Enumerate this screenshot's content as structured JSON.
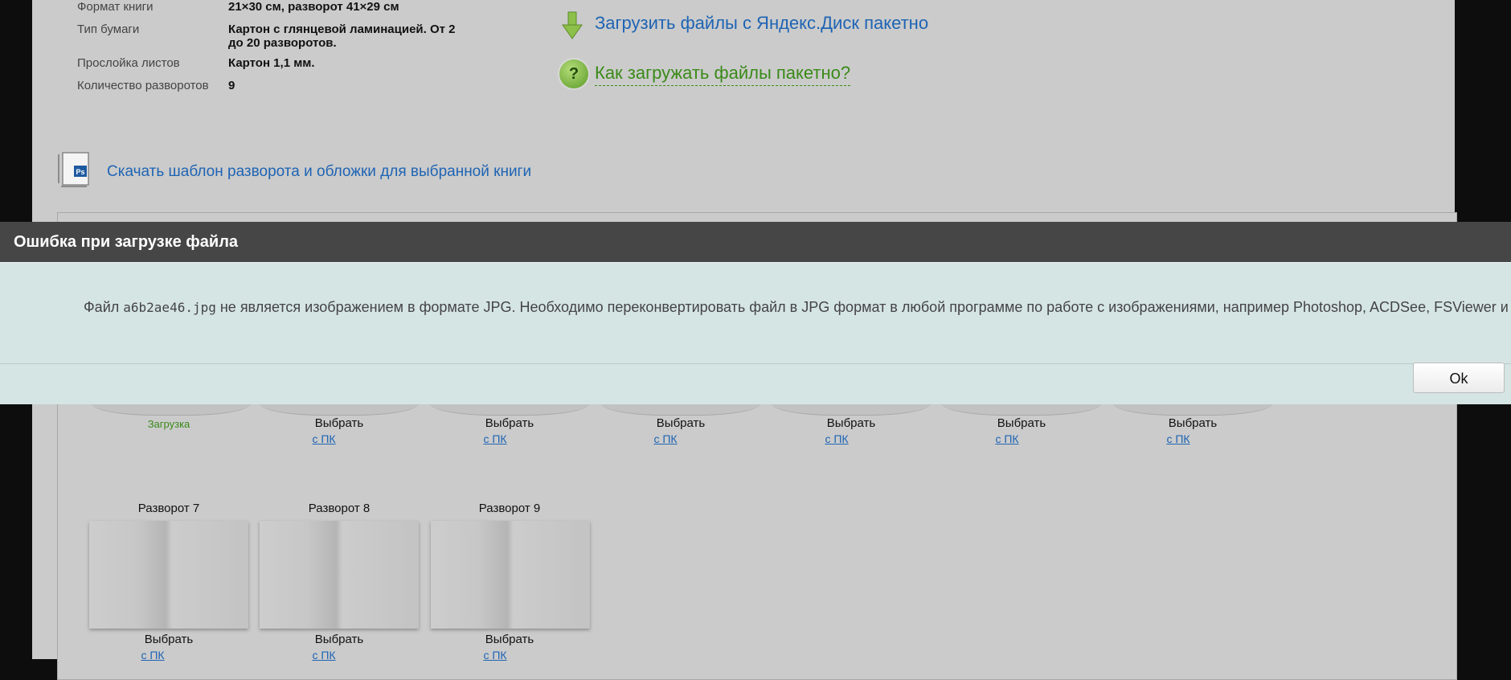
{
  "specs": [
    {
      "label": "Формат книги",
      "value": "21×30 см, разворот 41×29 см"
    },
    {
      "label": "Тип бумаги",
      "value": "Картон с глянцевой ламинацией. От 2 до 20 разворотов."
    },
    {
      "label": "Прослойка листов",
      "value": "Картон 1,1 мм."
    },
    {
      "label": "Количество разворотов",
      "value": "9"
    }
  ],
  "links": {
    "upload_yadisk": "Загрузить файлы с Яндекс.Диск пакетно",
    "how_upload": "Как загружать файлы пакетно?",
    "download_template": "Скачать шаблон разворота и обложки для выбранной книги"
  },
  "row1": {
    "loading": "Загрузка",
    "select_label": "Выбрать",
    "pc_label": "с ПК"
  },
  "row2": [
    {
      "title": "Разворот 7",
      "select": "Выбрать",
      "pc": "с ПК"
    },
    {
      "title": "Разворот 8",
      "select": "Выбрать",
      "pc": "с ПК"
    },
    {
      "title": "Разворот 9",
      "select": "Выбрать",
      "pc": "с ПК"
    }
  ],
  "dialog": {
    "title": "Ошибка при загрузке файла",
    "msg_prefix": "Файл ",
    "filename": "a6b2ae46.jpg",
    "msg_suffix": " не является изображением в формате JPG. Необходимо переконвертировать файл в JPG формат в любой программе по работе с изображениями, например Photoshop, ACDSee, FSViewer и др.",
    "ok_label": "Ok"
  },
  "colors": {
    "link_blue": "#1e64b4",
    "link_green": "#3a8a18",
    "dialog_header": "#464646",
    "dialog_body": "#d5e5e4"
  }
}
